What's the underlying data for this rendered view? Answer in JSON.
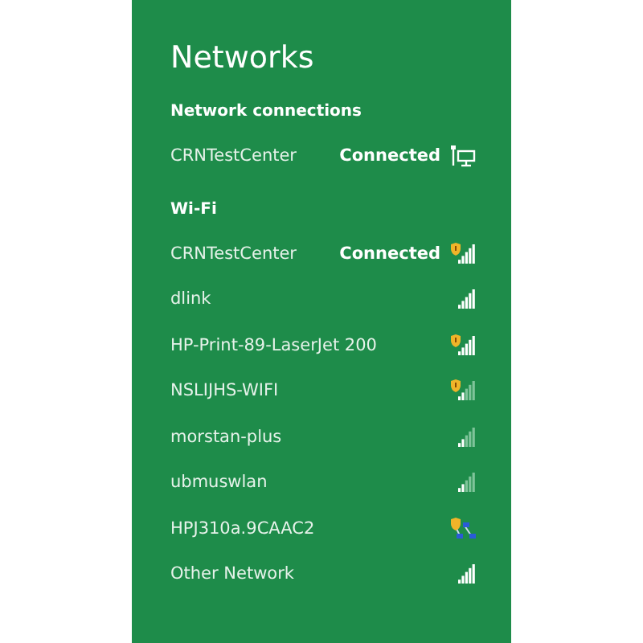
{
  "title": "Networks",
  "sections": [
    {
      "heading": "Network connections",
      "networks": [
        {
          "name": "CRNTestCenter",
          "status": "Connected",
          "kind": "wired"
        }
      ]
    },
    {
      "heading": "Wi-Fi",
      "networks": [
        {
          "name": "CRNTestCenter",
          "status": "Connected",
          "kind": "wifi",
          "weak_signal": false,
          "secured": true
        },
        {
          "name": "dlink",
          "kind": "wifi",
          "weak_signal": false,
          "secured": false
        },
        {
          "name": "HP-Print-89-LaserJet 200",
          "kind": "wifi",
          "weak_signal": false,
          "secured": true
        },
        {
          "name": "NSLIJHS-WIFI",
          "kind": "wifi",
          "weak_signal": true,
          "secured": true
        },
        {
          "name": "morstan-plus",
          "kind": "wifi",
          "weak_signal": true,
          "secured": false
        },
        {
          "name": "ubmuswlan",
          "kind": "wifi",
          "weak_signal": true,
          "secured": false
        },
        {
          "name": "HPJ310a.9CAAC2",
          "kind": "adhoc",
          "secured": true
        },
        {
          "name": "Other Network",
          "kind": "wifi",
          "weak_signal": false,
          "secured": false
        }
      ]
    }
  ]
}
